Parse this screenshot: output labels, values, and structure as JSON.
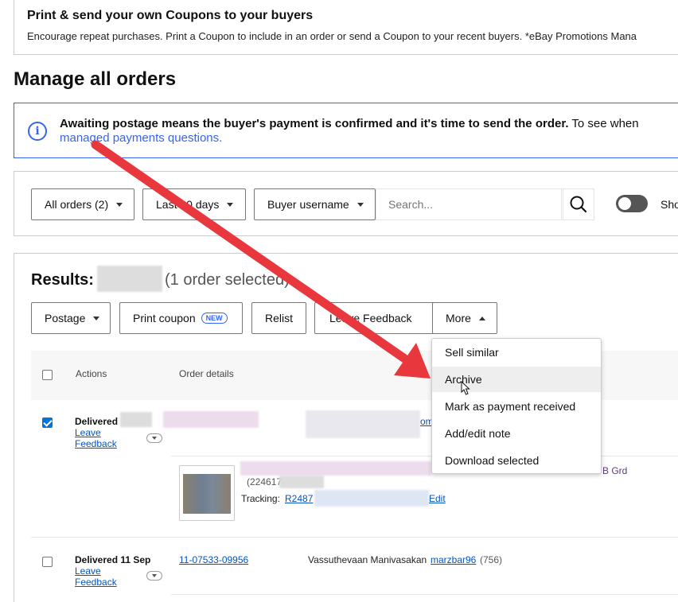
{
  "promo": {
    "title": "Print & send your own Coupons to your buyers",
    "description": "Encourage repeat purchases. Print a Coupon to include in an order or send a Coupon to your recent buyers. *eBay Promotions Mana"
  },
  "page_title": "Manage all orders",
  "info": {
    "bold_text": "Awaiting postage means the buyer's payment is confirmed and it's time to send the order.",
    "rest_text": " To see when",
    "link": "managed payments questions."
  },
  "filters": {
    "orders": "All orders (2)",
    "period": "Last 90 days",
    "search_by": "Buyer username",
    "search_placeholder": "Search...",
    "toggle_label": "Sho"
  },
  "results": {
    "label": "Results:",
    "selected": "(1 order selected)"
  },
  "actions": {
    "postage": "Postage",
    "print_coupon": "Print coupon",
    "new_badge": "NEW",
    "relist": "Relist",
    "leave_feedback": "Leave Feedback",
    "more": "More"
  },
  "table": {
    "col_actions": "Actions",
    "col_order_details": "Order details"
  },
  "rows": [
    {
      "status": "Delivered",
      "leave_feedback_1": "Leave",
      "leave_feedback_2": "Feedback",
      "item_id_partial": "(224617",
      "tracking_label": "Tracking:",
      "tracking_partial": "R2487",
      "edit": "Edit",
      "buyer_link_partial": "om",
      "postage_partial": "B Grd"
    },
    {
      "status": "Delivered 11 Sep",
      "leave_feedback_1": "Leave",
      "leave_feedback_2": "Feedback",
      "order_id": "11-07533-09956",
      "buyer_name": "Vassuthevaan Manivasakan",
      "buyer_username": "marzbar96",
      "feedback_score": "(756)"
    }
  ],
  "more_menu": [
    "Sell similar",
    "Archive",
    "Mark as payment received",
    "Add/edit note",
    "Download selected"
  ],
  "colors": {
    "accent": "#3665f3",
    "link": "#0654ba",
    "arrow": "#e8373d"
  }
}
